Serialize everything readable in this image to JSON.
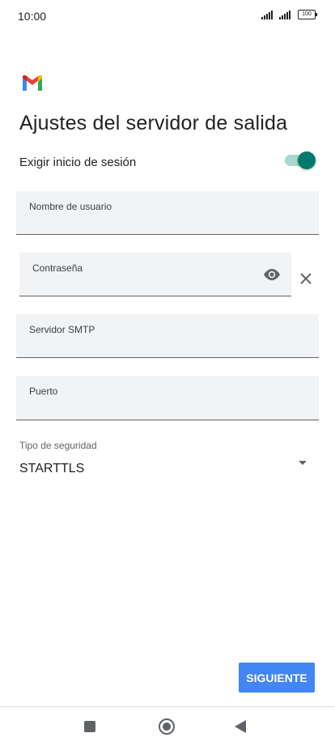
{
  "status_bar": {
    "time": "10:00",
    "battery": "100"
  },
  "page": {
    "title": "Ajustes del servidor de salida"
  },
  "login_toggle": {
    "label": "Exigir inicio de sesión",
    "enabled": true
  },
  "fields": {
    "username": {
      "label": "Nombre de usuario",
      "value": ""
    },
    "password": {
      "label": "Contraseña",
      "value": ""
    },
    "smtp_server": {
      "label": "Servidor SMTP",
      "value": ""
    },
    "port": {
      "label": "Puerto",
      "value": ""
    }
  },
  "security": {
    "label": "Tipo de seguridad",
    "value": "STARTTLS"
  },
  "actions": {
    "next_label": "SIGUIENTE"
  },
  "colors": {
    "accent": "#00796b",
    "button": "#4285f4",
    "field_bg": "#f1f3f4"
  },
  "icons": [
    "gmail-logo",
    "visibility-icon",
    "close-icon",
    "dropdown-arrow-icon",
    "recents-icon",
    "home-icon",
    "back-icon"
  ]
}
